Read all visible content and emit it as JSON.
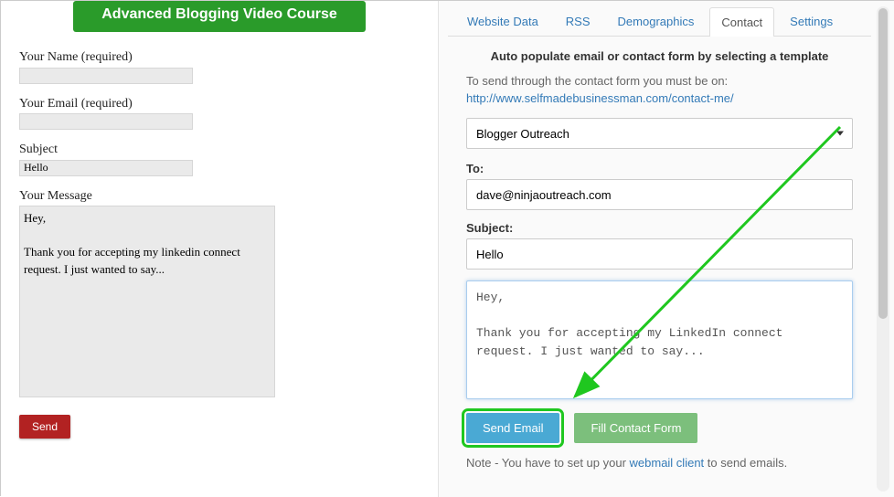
{
  "banner": {
    "title": "Advanced Blogging Video Course"
  },
  "left_form": {
    "name_label": "Your Name (required)",
    "name_value": "",
    "email_label": "Your Email (required)",
    "email_value": "",
    "subject_label": "Subject",
    "subject_value": "Hello",
    "message_label": "Your Message",
    "message_value": "Hey,\n\nThank you for accepting my linkedin connect request. I just wanted to say...",
    "send_label": "Send"
  },
  "right_panel": {
    "tabs": [
      {
        "label": "Website Data",
        "active": false
      },
      {
        "label": "RSS",
        "active": false
      },
      {
        "label": "Demographics",
        "active": false
      },
      {
        "label": "Contact",
        "active": true
      },
      {
        "label": "Settings",
        "active": false
      }
    ],
    "heading": "Auto populate email or contact form by selecting a template",
    "hint_text": "To send through the contact form you must be on:",
    "hint_url": "http://www.selfmadebusinessman.com/contact-me/",
    "template_select": "Blogger Outreach",
    "to_label": "To:",
    "to_value": "dave@ninjaoutreach.com",
    "subject_label": "Subject:",
    "subject_value": "Hello",
    "body_value": "Hey,\n\nThank you for accepting my LinkedIn connect request. I just wanted to say...",
    "send_email_label": "Send Email",
    "fill_form_label": "Fill Contact Form",
    "note_prefix": "Note - You have to set up your ",
    "note_link": "webmail client",
    "note_suffix": " to send emails."
  }
}
